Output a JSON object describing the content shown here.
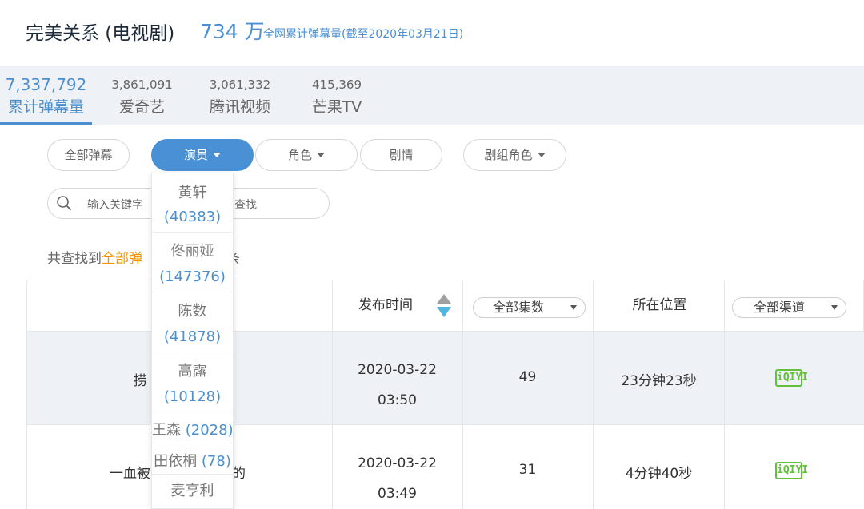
{
  "header": {
    "title": "完美关系 (电视剧)",
    "total": "734 万",
    "caption": "全网累计弹幕量(截至2020年03月21日)"
  },
  "stats": [
    {
      "value": "7,337,792",
      "label": "累计弹幕量",
      "active": true
    },
    {
      "value": "3,861,091",
      "label": "爱奇艺"
    },
    {
      "value": "3,061,332",
      "label": "腾讯视频"
    },
    {
      "value": "415,369",
      "label": "芒果TV"
    }
  ],
  "filters": {
    "all": "全部弹幕",
    "actor": "演员",
    "role": "角色",
    "plot": "剧情",
    "crew_role": "剧组角色"
  },
  "search": {
    "placeholder_left": "输入关键字",
    "placeholder_right": "步查找"
  },
  "results": {
    "prefix": "共查找到",
    "highlight": "全部弹",
    "suffix": "2条"
  },
  "table": {
    "headers": {
      "content": "",
      "time": "发布时间",
      "episode_select": "全部集数",
      "position": "所在位置",
      "channel_select": "全部渠道"
    },
    "rows": [
      {
        "content_left": "捞",
        "content_right": "",
        "date": "2020-03-22",
        "time": "03:50",
        "episode": "49",
        "position": "23分钟23秒",
        "channel": "iQIYI"
      },
      {
        "content_left": "一血被",
        "content_right": "的",
        "date": "2020-03-22",
        "time": "03:49",
        "episode": "31",
        "position": "4分钟40秒",
        "channel": "iQIYI"
      }
    ]
  },
  "actor_dropdown": {
    "items": [
      {
        "name": "黄轩",
        "count": "(40383)"
      },
      {
        "name": "佟丽娅",
        "count": "(147376)"
      },
      {
        "name": "陈数",
        "count": "(41878)"
      },
      {
        "name": "高露",
        "count": "(10128)"
      },
      {
        "name": "王森",
        "count": "(2028)"
      },
      {
        "name": "田依桐",
        "count": "(78)"
      },
      {
        "name": "麦亨利",
        "count": ""
      }
    ]
  },
  "colors": {
    "accent": "#4a8fd0",
    "highlight": "#f39200",
    "iqiyi_green": "#62c13b"
  }
}
